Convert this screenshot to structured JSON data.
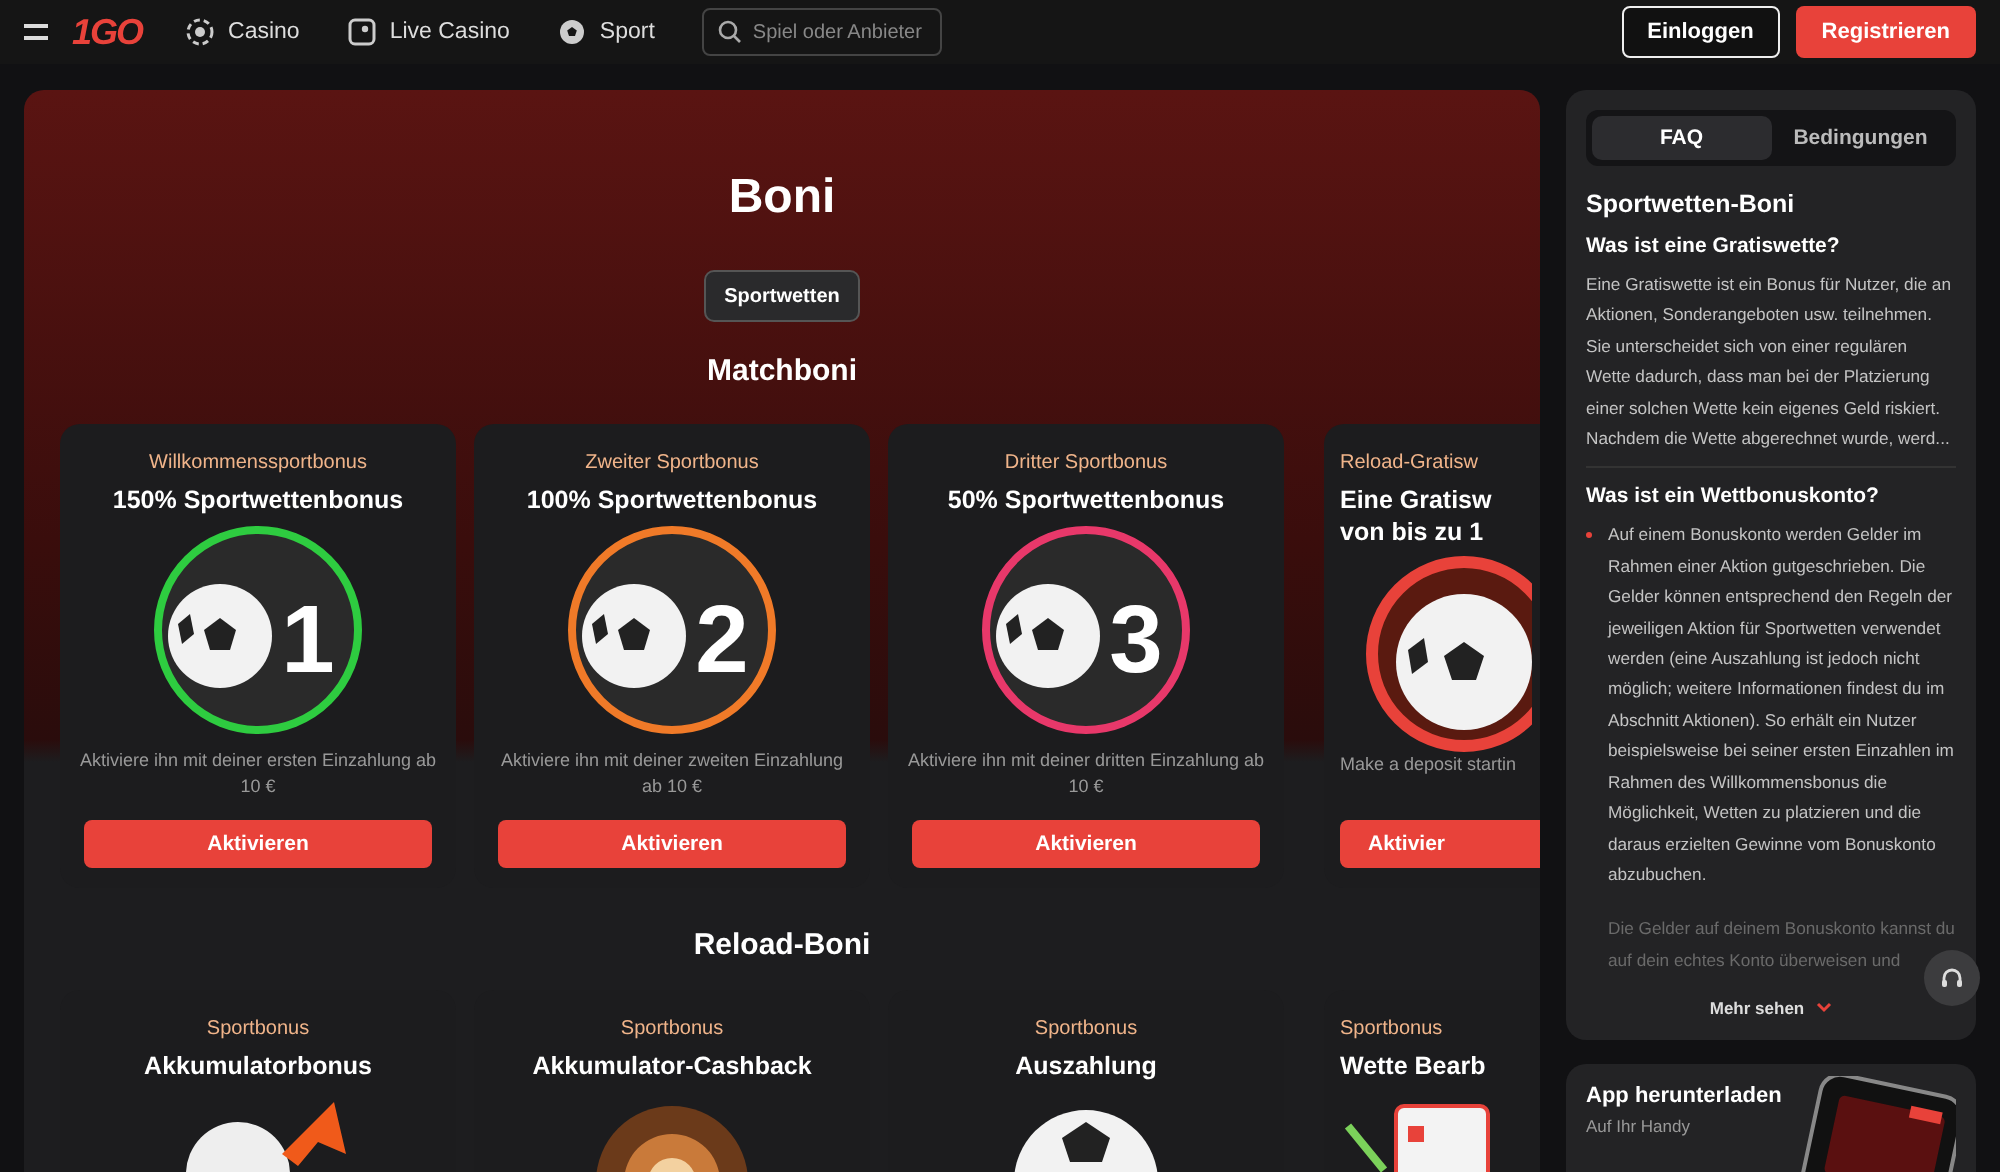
{
  "header": {
    "logo": "1GO",
    "nav": [
      {
        "label": "Casino",
        "kind": "chip"
      },
      {
        "label": "Live Casino",
        "kind": "live"
      },
      {
        "label": "Sport",
        "kind": "ball"
      }
    ],
    "search": {
      "placeholder": "Spiel oder Anbieter"
    },
    "buttons": [
      {
        "label": "Einloggen",
        "kind": "outline"
      },
      {
        "label": "Registrieren",
        "kind": "primary"
      }
    ]
  },
  "hero": {
    "title": "Boni",
    "tabs": [
      {
        "label": "Sportwetten",
        "selected": true
      }
    ],
    "section_title": "Matchboni"
  },
  "match_cards": [
    {
      "kind": "number",
      "category": "Willkommenssportbonus",
      "title": "150% Sportwettenbonus",
      "number": "1",
      "color": "#2ecc40",
      "description": "Aktiviere ihn mit deiner ersten Einzahlung ab 10 €",
      "button": "Aktivieren"
    },
    {
      "kind": "number",
      "category": "Zweiter Sportbonus",
      "title": "100% Sportwettenbonus",
      "number": "2",
      "color": "#f07a28",
      "description": "Aktiviere ihn mit deiner zweiten Einzahlung ab 10 €",
      "button": "Aktivieren"
    },
    {
      "kind": "number",
      "category": "Dritter Sportbonus",
      "title": "50% Sportwettenbonus",
      "number": "3",
      "color": "#e8386a",
      "description": "Aktiviere ihn mit deiner dritten Einzahlung ab 10 €",
      "button": "Aktivieren"
    },
    {
      "kind": "ring",
      "category": "Reload-Gratisw",
      "title": "Eine Gratisw\nvon bis zu 1",
      "description": "Make a deposit startin",
      "button": "Aktivier"
    }
  ],
  "reload": {
    "title": "Reload-Boni",
    "cards": [
      {
        "kind": "arrow",
        "category": "Sportbonus",
        "title": "Akkumulatorbonus"
      },
      {
        "kind": "wheel",
        "category": "Sportbonus",
        "title": "Akkumulator-Cashback"
      },
      {
        "kind": "ball",
        "category": "Sportbonus",
        "title": "Auszahlung"
      },
      {
        "kind": "clipboard",
        "category": "Sportbonus",
        "title": "Wette Bearb"
      }
    ]
  },
  "faq": {
    "tabs": [
      {
        "label": "FAQ",
        "selected": true
      },
      {
        "label": "Bedingungen",
        "selected": false
      }
    ],
    "heading": "Sportwetten-Boni",
    "items": [
      {
        "kind": "text",
        "question": "Was ist eine Gratiswette?",
        "paragraphs": [
          "Eine Gratiswette ist ein Bonus für Nutzer, die an Aktionen, Sonderangeboten usw. teilnehmen. Sie unterscheidet sich von einer regulären Wette dadurch, dass man bei der Platzierung einer solchen Wette kein eigenes Geld riskiert. Nachdem die Wette abgerechnet wurde, werd..."
        ]
      },
      {
        "kind": "bullets",
        "question": "Was ist ein Wettbonuskonto?",
        "bullets": [
          "Auf einem Bonuskonto werden Gelder im Rahmen einer Aktion gutgeschrieben. Die Gelder können entsprechend den Regeln der jeweiligen Aktion für Sportwetten verwendet werden (eine Auszahlung ist jedoch nicht möglich; weitere Informationen findest du im Abschnitt Aktionen). So erhält ein Nutzer beispielsweise bei seiner ersten Einzahlen im Rahmen des Willkommensbonus die Möglichkeit, Wetten zu platzieren und die daraus erzielten Gewinne vom Bonuskonto abzubuchen."
        ],
        "paragraphs": [
          "Die Gelder auf deinem Bonuskonto kannst du auf dein echtes Konto überweisen und"
        ]
      }
    ],
    "more": "Mehr sehen"
  },
  "app": {
    "title": "App herunterladen",
    "subtitle": "Auf Ihr Handy"
  }
}
